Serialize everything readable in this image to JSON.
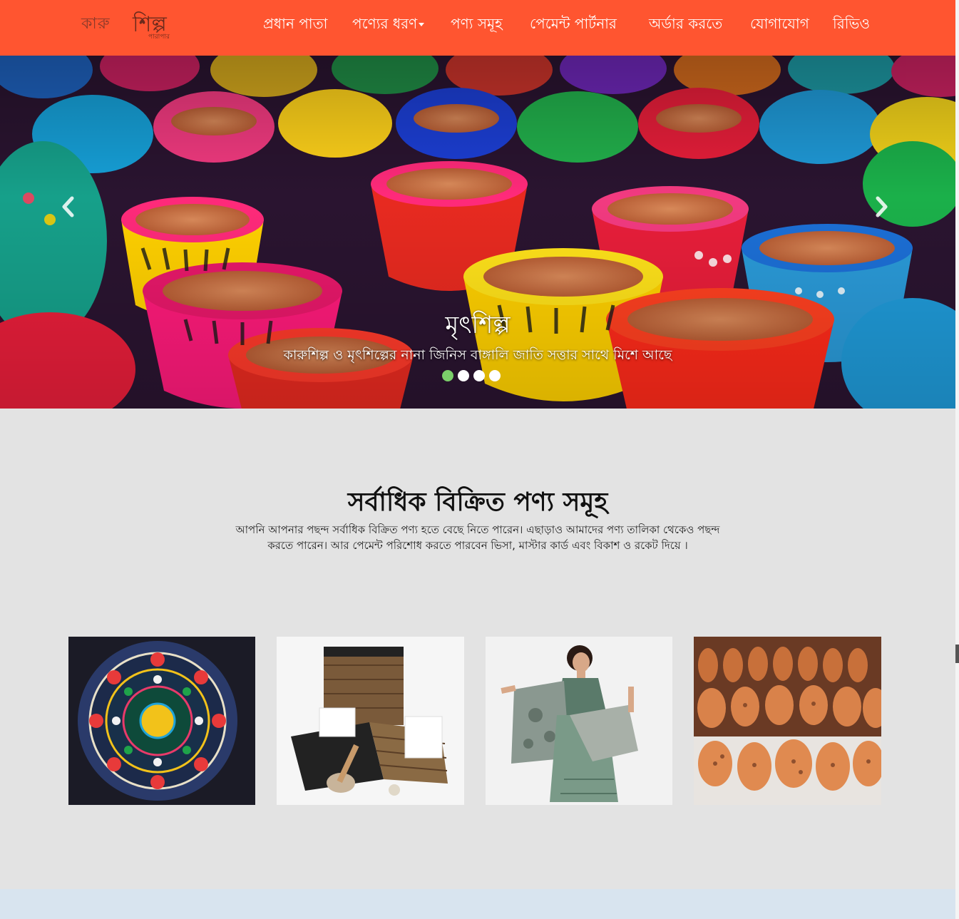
{
  "brand": {
    "logo_word1": "কারু",
    "logo_word2": "শিল্প",
    "logo_sub": "পারাপার"
  },
  "nav": {
    "items": [
      {
        "label": "প্রধান পাতা"
      },
      {
        "label": "পণ্যের ধরণ",
        "has_dropdown": true
      },
      {
        "label": "পণ্য সমূহ"
      },
      {
        "label": "পেমেন্ট পার্টনার"
      },
      {
        "label": "অর্ডার করতে"
      },
      {
        "label": "যোগাযোগ"
      },
      {
        "label": "রিভিও"
      }
    ]
  },
  "carousel": {
    "title": "মৃৎশিল্প",
    "text": "কারুশিল্প ও মৃৎশিল্পের নানা জিনিস বাঙ্গালি জাতি সত্তার সাথে মিশে আছে",
    "slide_count": 4,
    "active_index": 0,
    "image": "colorful painted clay pots"
  },
  "bestseller": {
    "title": "সর্বাধিক বিক্রিত পণ্য সমূহ",
    "description": "আপনি আপনার পছন্দ সর্বাধিক বিক্রিত পণ্য হতে বেছে নিতে পারেন। এছাড়াও আমাদের পণ্য তালিকা থেকেও পছন্দ করতে পারেন। আর পেমেন্ট পরিশোধ করতে পারবেন ভিসা, মাস্টার কার্ড এবং বিকাশ ও রকেট দিয়ে ।",
    "products": [
      {
        "image": "embroidered nakshi kantha"
      },
      {
        "image": "woven baskets"
      },
      {
        "image": "woman in saree"
      },
      {
        "image": "terracotta pottery"
      }
    ]
  },
  "colors": {
    "navbar": "#ff5530",
    "section_bg": "#e3e3e3",
    "active_dot": "#7bcf6a",
    "footer_strip": "#d8e4ef"
  }
}
